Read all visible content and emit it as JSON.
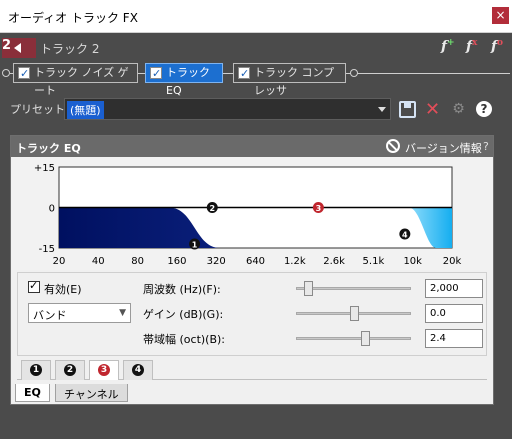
{
  "window": {
    "title": "オーディオ トラック FX",
    "close_label": "×"
  },
  "track": {
    "number": "2",
    "name": "トラック 2"
  },
  "fx_icons": [
    "fx-add-icon",
    "fx-remove-icon",
    "fx-chain-icon"
  ],
  "chain": {
    "plugins": [
      {
        "label": "トラック ノイズ ゲート",
        "checked": true,
        "active": false
      },
      {
        "label": "トラック EQ",
        "checked": true,
        "active": true
      },
      {
        "label": "トラック コンプレッサ",
        "checked": true,
        "active": false
      }
    ]
  },
  "preset": {
    "label": "プリセット:",
    "value": "(無題)"
  },
  "panel": {
    "title": "トラック EQ",
    "version_label": "バージョン情報",
    "help": "?"
  },
  "chart_data": {
    "type": "area",
    "y_ticks": [
      "+15",
      "0",
      "-15"
    ],
    "ylim": [
      -15,
      15
    ],
    "x_ticks": [
      "20",
      "40",
      "80",
      "160",
      "320",
      "640",
      "1.2k",
      "2.6k",
      "5.1k",
      "10k",
      "20k"
    ],
    "bands": [
      {
        "id": "1",
        "label": "❶"
      },
      {
        "id": "2",
        "label": "❷"
      },
      {
        "id": "3",
        "label": "❸"
      },
      {
        "id": "4",
        "label": "❹"
      }
    ],
    "colors": {
      "low": "#001060",
      "high": "#15aef0",
      "active_band": "#c0262e"
    }
  },
  "controls": {
    "enable_label": "有効(E)",
    "enabled": true,
    "filter_type": "バンド",
    "params": [
      {
        "label": "周波数 (Hz)(F):",
        "value": "2,000",
        "position": 0.07
      },
      {
        "label": "ゲイン (dB)(G):",
        "value": "0.0",
        "position": 0.5
      },
      {
        "label": "帯域幅 (oct)(B):",
        "value": "2.4",
        "position": 0.6
      }
    ]
  },
  "band_tabs": [
    {
      "label": "1",
      "active": false
    },
    {
      "label": "2",
      "active": false
    },
    {
      "label": "3",
      "active": true
    },
    {
      "label": "4",
      "active": false
    }
  ],
  "bottom_tabs": [
    {
      "label": "EQ",
      "active": true
    },
    {
      "label": "チャンネル",
      "active": false
    }
  ]
}
